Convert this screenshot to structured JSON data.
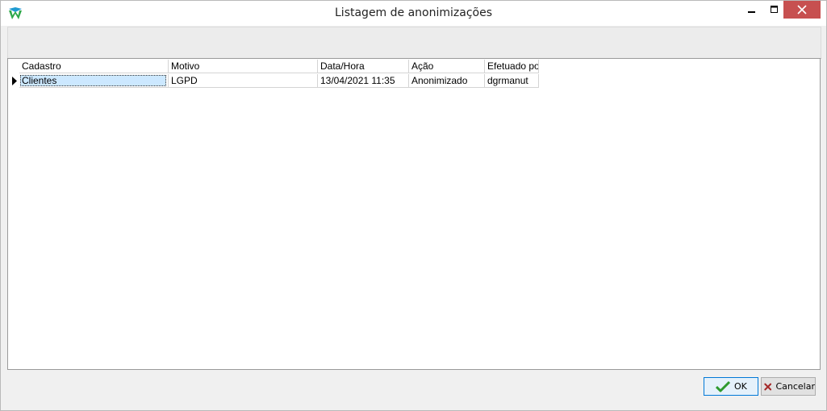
{
  "window": {
    "title": "Listagem de anonimizações",
    "icons": {
      "app": "app-logo-icon",
      "minimize": "minimize-icon",
      "maximize": "maximize-icon",
      "close": "close-icon"
    }
  },
  "grid": {
    "columns": [
      "Cadastro",
      "Motivo",
      "Data/Hora",
      "Ação",
      "Efetuado por"
    ],
    "rows": [
      [
        "Clientes",
        "LGPD",
        "13/04/2021 11:35",
        "Anonimizado",
        "dgrmanut"
      ]
    ]
  },
  "footer": {
    "ok_label": "OK",
    "cancel_label": "Cancelar",
    "icons": {
      "ok": "checkmark-icon",
      "cancel": "x-mark-icon"
    }
  },
  "colors": {
    "close_button": "#c75050",
    "ok_icon": "#2e9a2e",
    "cancel_icon": "#a52a2a",
    "selection": "#cce8ff"
  }
}
